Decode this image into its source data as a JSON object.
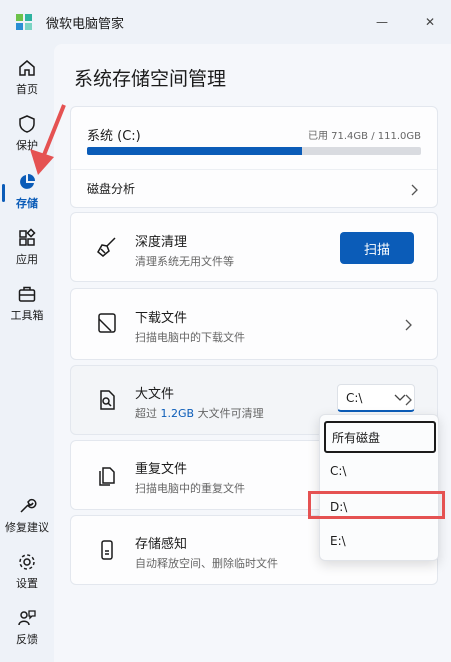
{
  "window": {
    "title": "微软电脑管家",
    "minimize_glyph": "—",
    "close_glyph": "✕"
  },
  "sidebar": {
    "items": [
      {
        "label": "首页",
        "icon": "home-icon"
      },
      {
        "label": "保护",
        "icon": "shield-icon"
      },
      {
        "label": "存储",
        "icon": "pie-chart-icon",
        "active": true
      },
      {
        "label": "应用",
        "icon": "apps-icon"
      },
      {
        "label": "工具箱",
        "icon": "toolbox-icon"
      },
      {
        "label": "修复建议",
        "icon": "wrench-icon"
      },
      {
        "label": "设置",
        "icon": "gear-icon"
      },
      {
        "label": "反馈",
        "icon": "feedback-icon"
      }
    ]
  },
  "main": {
    "page_title": "系统存储空间管理",
    "drive": {
      "name": "系统 (C:)",
      "usage_text": "已用 71.4GB / 111.0GB",
      "used_fraction": 0.643
    },
    "disk_analysis_label": "磁盘分析",
    "deep_clean": {
      "title": "深度清理",
      "subtitle": "清理系统无用文件等",
      "button": "扫描"
    },
    "downloads": {
      "title": "下载文件",
      "subtitle": "扫描电脑中的下载文件"
    },
    "large_files": {
      "title": "大文件",
      "subtitle_prefix": "超过",
      "subtitle_value": "1.2GB",
      "subtitle_suffix": "大文件可清理",
      "selected_drive": "C:\\"
    },
    "duplicates": {
      "title": "重复文件",
      "subtitle": "扫描电脑中的重复文件"
    },
    "storage_sense": {
      "title": "存储感知",
      "subtitle": "自动释放空间、删除临时文件"
    }
  },
  "dropdown": {
    "options": [
      "所有磁盘",
      "C:\\",
      "D:\\",
      "E:\\"
    ],
    "focused_index": 0,
    "highlighted_index": 2
  },
  "colors": {
    "accent": "#0b5cb8",
    "annotation": "#e55252"
  }
}
